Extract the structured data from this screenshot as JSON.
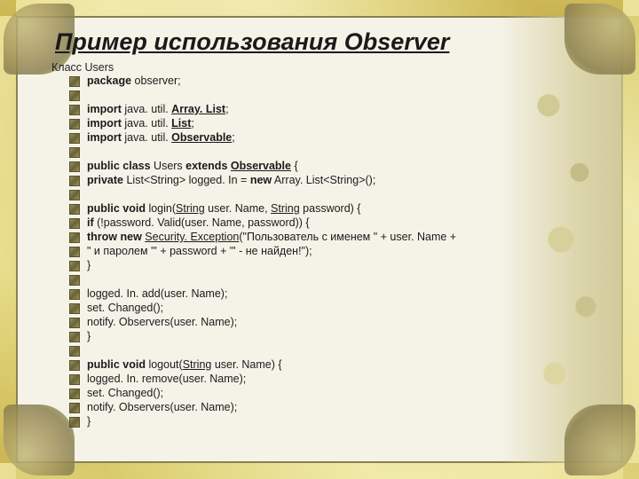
{
  "title": "Пример использования Observer",
  "subtitle": "Класс Users",
  "code": {
    "l1_1": "package",
    "l1_2": " observer;",
    "l2_1": "import",
    "l2_2": " java. util. ",
    "l2_3": "Array. List",
    "l2_4": ";",
    "l3_1": "import",
    "l3_2": " java. util. ",
    "l3_3": "List",
    "l3_4": ";",
    "l4_1": "import",
    "l4_2": " java. util. ",
    "l4_3": "Observable",
    "l4_4": ";",
    "l5_1": "public class",
    "l5_2": " Users ",
    "l5_3": "extends",
    "l5_4": " ",
    "l5_5": "Observable",
    "l5_6": " {",
    "l6_1": "private",
    "l6_2": " List<String> logged. In = ",
    "l6_3": "new",
    "l6_4": " Array. List<String>();",
    "l7_1": "public void",
    "l7_2": " login(",
    "l7_3": "String",
    "l7_4": " user. Name, ",
    "l7_5": "String",
    "l7_6": " password) {",
    "l8_1": "if",
    "l8_2": " (!password. Valid(user. Name, password)) {",
    "l9_1": "throw new",
    "l9_2": " ",
    "l9_3": "Security. Exception",
    "l9_4": "(\"Пользователь с именем \" + user. Name +",
    "l10": "\" и паролем '\" + password + \"' - не найден!\");",
    "l11": "}",
    "l12": "logged. In. add(user. Name);",
    "l13": "set. Changed();",
    "l14": "notify. Observers(user. Name);",
    "l15": "}",
    "l16_1": "public void",
    "l16_2": " logout(",
    "l16_3": "String",
    "l16_4": " user. Name) {",
    "l17": "logged. In. remove(user. Name);",
    "l18": "set. Changed();",
    "l19": "notify. Observers(user. Name);",
    "l20": "}"
  }
}
